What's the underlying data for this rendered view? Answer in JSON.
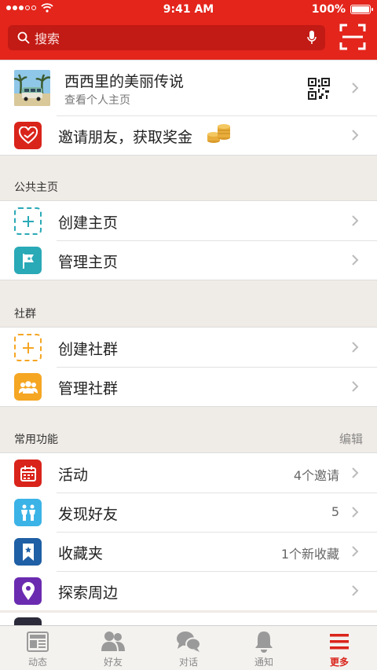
{
  "status_bar": {
    "time": "9:41 AM",
    "battery": "100%"
  },
  "search": {
    "placeholder": "搜索"
  },
  "profile": {
    "name": "西西里的美丽传说",
    "subtitle": "查看个人主页"
  },
  "invite": {
    "label": "邀请朋友，获取奖金"
  },
  "pages": {
    "title": "公共主页",
    "items": [
      {
        "label": "创建主页"
      },
      {
        "label": "管理主页"
      }
    ]
  },
  "groups": {
    "title": "社群",
    "items": [
      {
        "label": "创建社群"
      },
      {
        "label": "管理社群"
      }
    ]
  },
  "frequent": {
    "title": "常用功能",
    "action": "编辑",
    "items": [
      {
        "label": "活动",
        "value": "4个邀请"
      },
      {
        "label": "发现好友",
        "value": "5"
      },
      {
        "label": "收藏夹",
        "value": "1个新收藏"
      },
      {
        "label": "探索周边",
        "value": ""
      }
    ]
  },
  "tabbar": [
    {
      "label": "动态",
      "icon": "news-feed-icon"
    },
    {
      "label": "好友",
      "icon": "friends-icon"
    },
    {
      "label": "对话",
      "icon": "chat-icon"
    },
    {
      "label": "通知",
      "icon": "bell-icon"
    },
    {
      "label": "更多",
      "icon": "menu-icon",
      "active": true
    }
  ],
  "colors": {
    "brand": "#e3251c",
    "tab_active": "#d9241b",
    "add_page": "#2aa9b7",
    "add_group": "#f5a623"
  }
}
